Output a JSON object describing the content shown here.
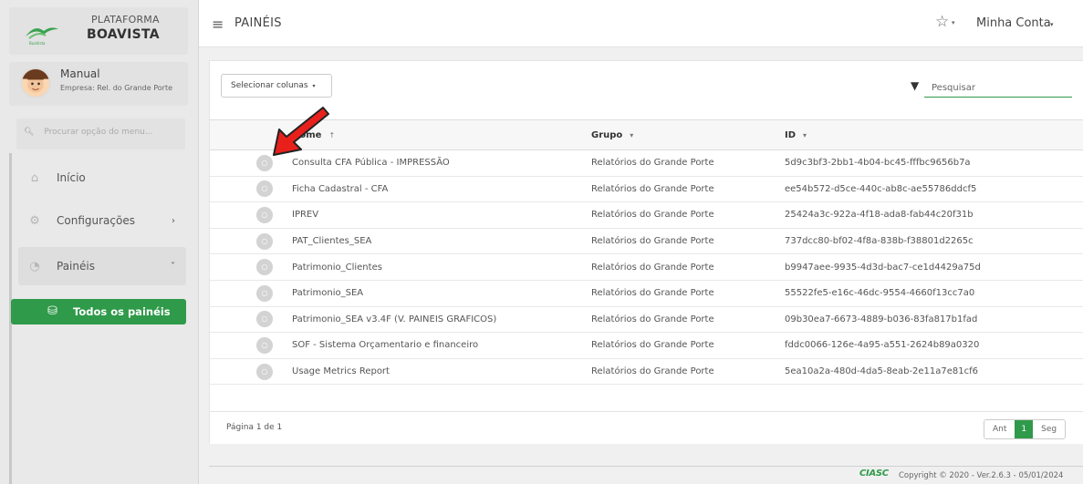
{
  "brand": {
    "line1": "PLATAFORMA",
    "line2": "BOAVISTA",
    "logo_caption": "BoaVista",
    "icon": "boavista-logo-icon"
  },
  "user": {
    "name": "Manual",
    "company": "Empresa: Rel. do Grande Porte"
  },
  "menu_search": {
    "placeholder": "Procurar opção do menu..."
  },
  "menu": [
    {
      "label": "Início",
      "icon": "home-icon"
    },
    {
      "label": "Configurações",
      "icon": "gear-icon",
      "chevron": "›"
    },
    {
      "label": "Painéis",
      "icon": "pie-chart-icon",
      "chevron": "˅"
    }
  ],
  "sidebar_button": {
    "label": "Todos os painéis",
    "icon": "database-icon"
  },
  "topbar": {
    "title": "PAINÉIS",
    "account": "Minha Conta"
  },
  "toolbar": {
    "select_columns": "Selecionar colunas",
    "search_placeholder": "Pesquisar"
  },
  "table": {
    "columns": [
      "",
      "Nome",
      "Grupo",
      "ID"
    ],
    "rows": [
      {
        "name": "Consulta CFA Pública - IMPRESSÃO",
        "group": "Relatórios do Grande Porte",
        "id": "5d9c3bf3-2bb1-4b04-bc45-fffbc9656b7a"
      },
      {
        "name": "Ficha Cadastral - CFA",
        "group": "Relatórios do Grande Porte",
        "id": "ee54b572-d5ce-440c-ab8c-ae55786ddcf5"
      },
      {
        "name": "IPREV",
        "group": "Relatórios do Grande Porte",
        "id": "25424a3c-922a-4f18-ada8-fab44c20f31b"
      },
      {
        "name": "PAT_Clientes_SEA",
        "group": "Relatórios do Grande Porte",
        "id": "737dcc80-bf02-4f8a-838b-f38801d2265c"
      },
      {
        "name": "Patrimonio_Clientes",
        "group": "Relatórios do Grande Porte",
        "id": "b9947aee-9935-4d3d-bac7-ce1d4429a75d"
      },
      {
        "name": "Patrimonio_SEA",
        "group": "Relatórios do Grande Porte",
        "id": "55522fe5-e16c-46dc-9554-4660f13cc7a0"
      },
      {
        "name": "Patrimonio_SEA v3.4F (V. PAINEIS GRAFICOS)",
        "group": "Relatórios do Grande Porte",
        "id": "09b30ea7-6673-4889-b036-83fa817b1fad"
      },
      {
        "name": "SOF - Sistema Orçamentario e financeiro",
        "group": "Relatórios do Grande Porte",
        "id": "fddc0066-126e-4a95-a551-2624b89a0320"
      },
      {
        "name": "Usage Metrics Report",
        "group": "Relatórios do Grande Porte",
        "id": "5ea10a2a-480d-4da5-8eab-2e11a7e81cf6"
      }
    ]
  },
  "pagination": {
    "info": "Página 1 de 1",
    "prev": "Ant",
    "current": "1",
    "next": "Seg"
  },
  "footer": {
    "brand": "CIASC",
    "copyright": "Copyright © 2020 - Ver.2.6.3 - 05/01/2024"
  },
  "colors": {
    "accent": "#2f9a4a",
    "arrow": "#e8201c"
  }
}
